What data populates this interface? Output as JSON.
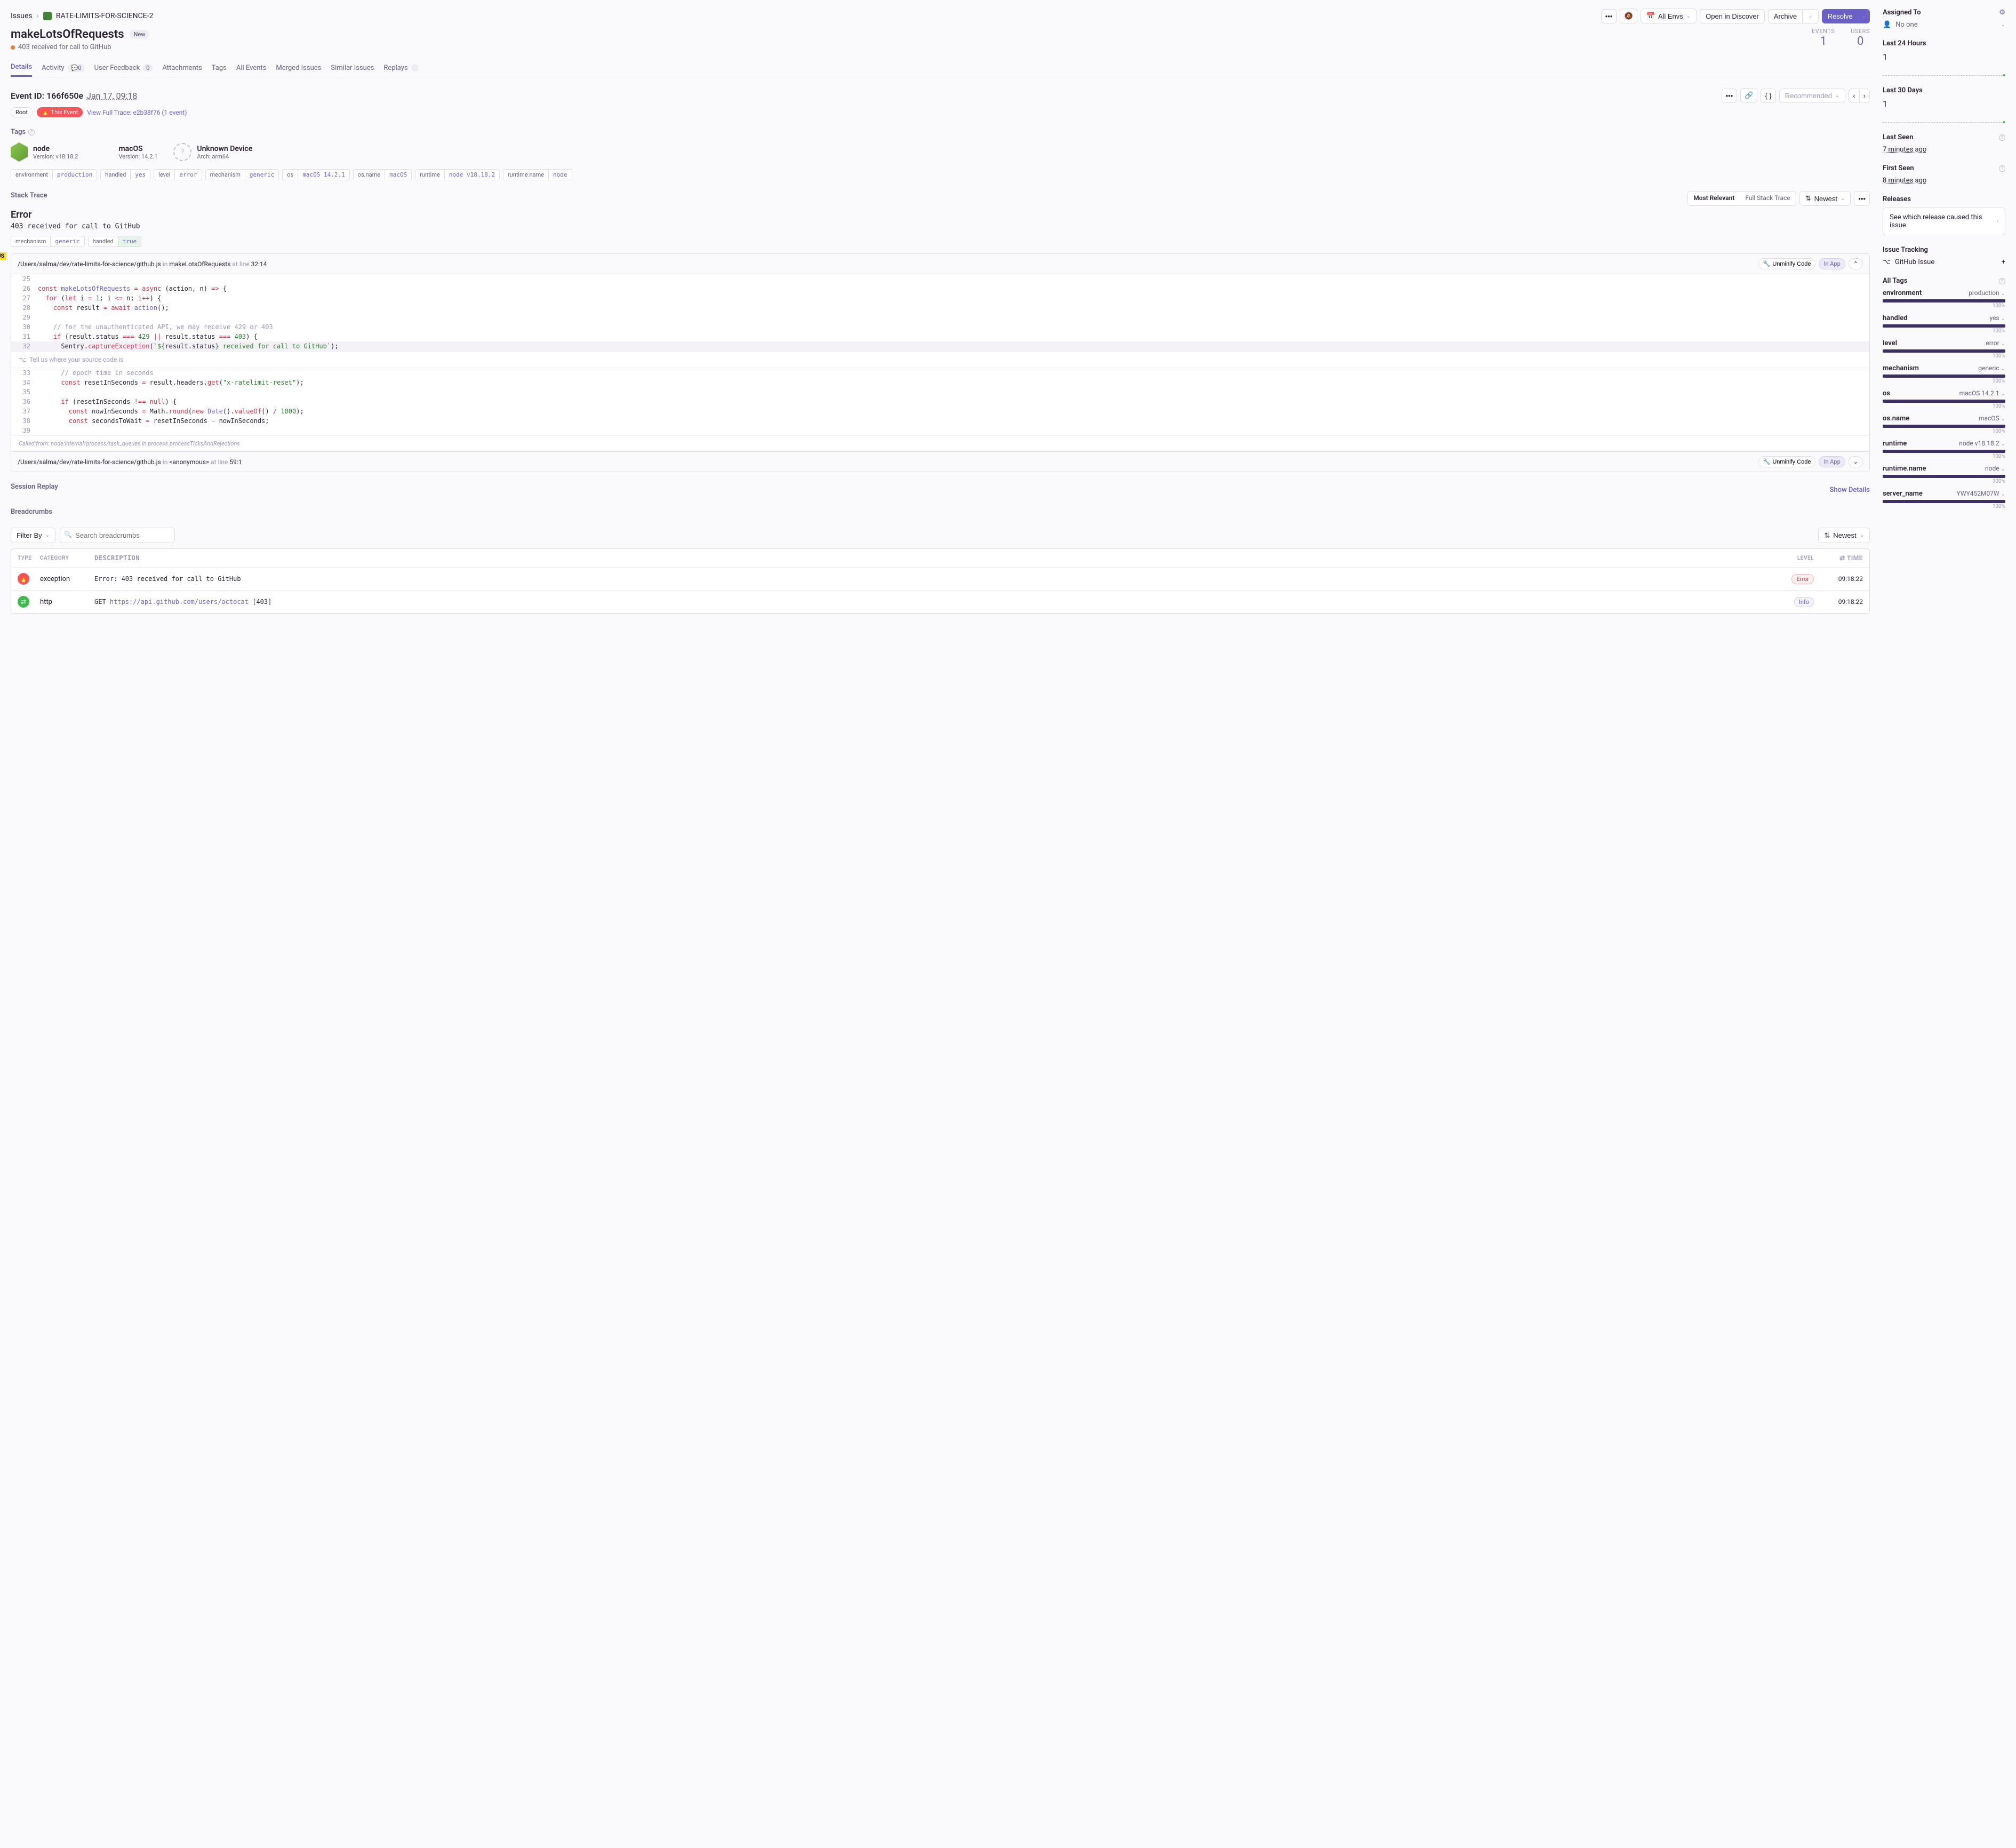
{
  "breadcrumb": {
    "issues": "Issues",
    "project": "RATE-LIMITS-FOR-SCIENCE-2"
  },
  "top_actions": {
    "all_envs": "All Envs",
    "open_discover": "Open in Discover",
    "archive": "Archive",
    "resolve": "Resolve"
  },
  "title": "makeLotsOfRequests",
  "title_badge": "New",
  "subtitle": "403 received for call to GitHub",
  "stats": {
    "events_lbl": "EVENTS",
    "events_val": "1",
    "users_lbl": "USERS",
    "users_val": "0"
  },
  "tabs": {
    "details": "Details",
    "activity": "Activity",
    "activity_count": "0",
    "feedback": "User Feedback",
    "feedback_count": "0",
    "attachments": "Attachments",
    "tags": "Tags",
    "all_events": "All Events",
    "merged": "Merged Issues",
    "similar": "Similar Issues",
    "replays": "Replays"
  },
  "event": {
    "id_lbl": "Event ID:",
    "id": "166f650e",
    "date": "Jan 17, 09:18",
    "root": "Root",
    "this_event": "This Event",
    "trace": "View Full Trace: e2b38f76 (1 event)",
    "recommended": "Recommended"
  },
  "tags_title": "Tags",
  "os": {
    "node": {
      "name": "node",
      "ver": "Version: v18.18.2"
    },
    "mac": {
      "name": "macOS",
      "ver": "Version: 14.2.1"
    },
    "unk": {
      "name": "Unknown Device",
      "ver": "Arch: arm64"
    }
  },
  "tag_pills": [
    {
      "k": "environment",
      "v": "production"
    },
    {
      "k": "handled",
      "v": "yes"
    },
    {
      "k": "level",
      "v": "error"
    },
    {
      "k": "mechanism",
      "v": "generic"
    },
    {
      "k": "os",
      "v": "macOS 14.2.1"
    },
    {
      "k": "os.name",
      "v": "macOS"
    },
    {
      "k": "runtime",
      "v": "node v18.18.2"
    },
    {
      "k": "runtime.name",
      "v": "node"
    }
  ],
  "st": {
    "title": "Stack Trace",
    "most_relevant": "Most Relevant",
    "full": "Full Stack Trace",
    "newest": "Newest",
    "error": "Error",
    "msg": "403 received for call to GitHub"
  },
  "st_tags": [
    {
      "k": "mechanism",
      "v": "generic"
    },
    {
      "k": "handled",
      "v": "true",
      "green": true
    }
  ],
  "frame1": {
    "path": "/Users/salma/dev/rate-limits-for-science/github.js",
    "in": "in",
    "fn": "makeLotsOfRequests",
    "at": "at line",
    "loc": "32:14",
    "unminify": "Unminify Code",
    "inapp": "In App"
  },
  "tell_us": "Tell us where your source code is",
  "called_from": "Called from: node:internal/process/task_queues  in  process.processTicksAndRejections",
  "frame2": {
    "path": "/Users/salma/dev/rate-limits-for-science/github.js",
    "in": "in",
    "fn": "<anonymous>",
    "at": "at line",
    "loc": "59:1",
    "unminify": "Unminify Code",
    "inapp": "In App"
  },
  "replay": {
    "title": "Session Replay",
    "show": "Show Details"
  },
  "bc": {
    "title": "Breadcrumbs",
    "filter": "Filter By",
    "search_ph": "Search breadcrumbs",
    "newest": "Newest",
    "head": {
      "type": "TYPE",
      "cat": "CATEGORY",
      "desc": "DESCRIPTION",
      "level": "LEVEL",
      "time": "TIME"
    },
    "rows": [
      {
        "icon": "exc",
        "cat": "exception",
        "desc_pre": "Error: ",
        "desc": "403 received for call to GitHub",
        "level": "Error",
        "time": "09:18:22"
      },
      {
        "icon": "http",
        "cat": "http",
        "desc_pre": "GET ",
        "desc_link": "https://api.github.com/users/octocat",
        "desc_post": " [403]",
        "level": "Info",
        "time": "09:18:22"
      }
    ]
  },
  "sb": {
    "assigned": "Assigned To",
    "noone": "No one",
    "last24": "Last 24 Hours",
    "last24_val": "1",
    "last30": "Last 30 Days",
    "last30_val": "1",
    "last_seen": "Last Seen",
    "last_seen_val": "7 minutes ago",
    "first_seen": "First Seen",
    "first_seen_val": "8 minutes ago",
    "releases": "Releases",
    "release_link": "See which release caused this issue",
    "tracking": "Issue Tracking",
    "gh": "GitHub Issue",
    "all_tags": "All Tags",
    "tags": [
      {
        "k": "environment",
        "v": "production",
        "pct": "100%"
      },
      {
        "k": "handled",
        "v": "yes",
        "pct": "100%"
      },
      {
        "k": "level",
        "v": "error",
        "pct": "100%"
      },
      {
        "k": "mechanism",
        "v": "generic",
        "pct": "100%"
      },
      {
        "k": "os",
        "v": "macOS 14.2.1",
        "pct": "100%"
      },
      {
        "k": "os.name",
        "v": "macOS",
        "pct": "100%"
      },
      {
        "k": "runtime",
        "v": "node v18.18.2",
        "pct": "100%"
      },
      {
        "k": "runtime.name",
        "v": "node",
        "pct": "100%"
      },
      {
        "k": "server_name",
        "v": "YWY452M07W",
        "pct": "100%"
      }
    ]
  }
}
